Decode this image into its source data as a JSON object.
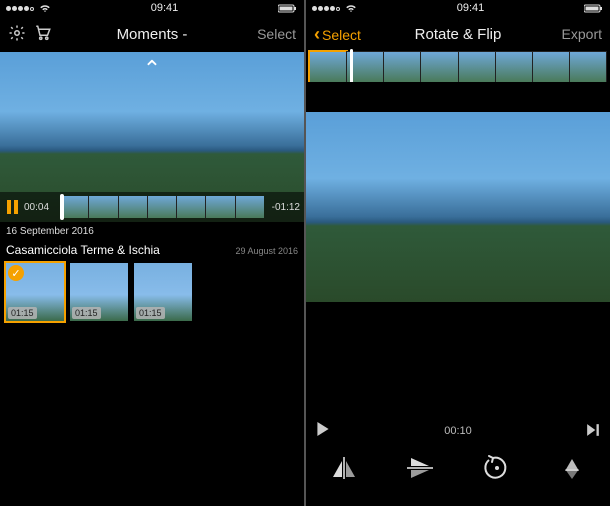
{
  "status": {
    "time": "09:41"
  },
  "left": {
    "nav": {
      "title": "Moments -",
      "select_label": "Select"
    },
    "scrubber": {
      "current": "00:04",
      "remaining": "-01:12"
    },
    "date": "16 September 2016",
    "location": "Casamicciola Terme & Ischia",
    "date2": "29 August 2016",
    "thumbs": [
      {
        "duration": "01:15",
        "selected": true
      },
      {
        "duration": "01:15",
        "selected": false
      },
      {
        "duration": "01:15",
        "selected": false
      }
    ]
  },
  "right": {
    "nav": {
      "back_label": "Select",
      "title": "Rotate & Flip",
      "export_label": "Export"
    },
    "playback": {
      "time": "00:10"
    }
  }
}
